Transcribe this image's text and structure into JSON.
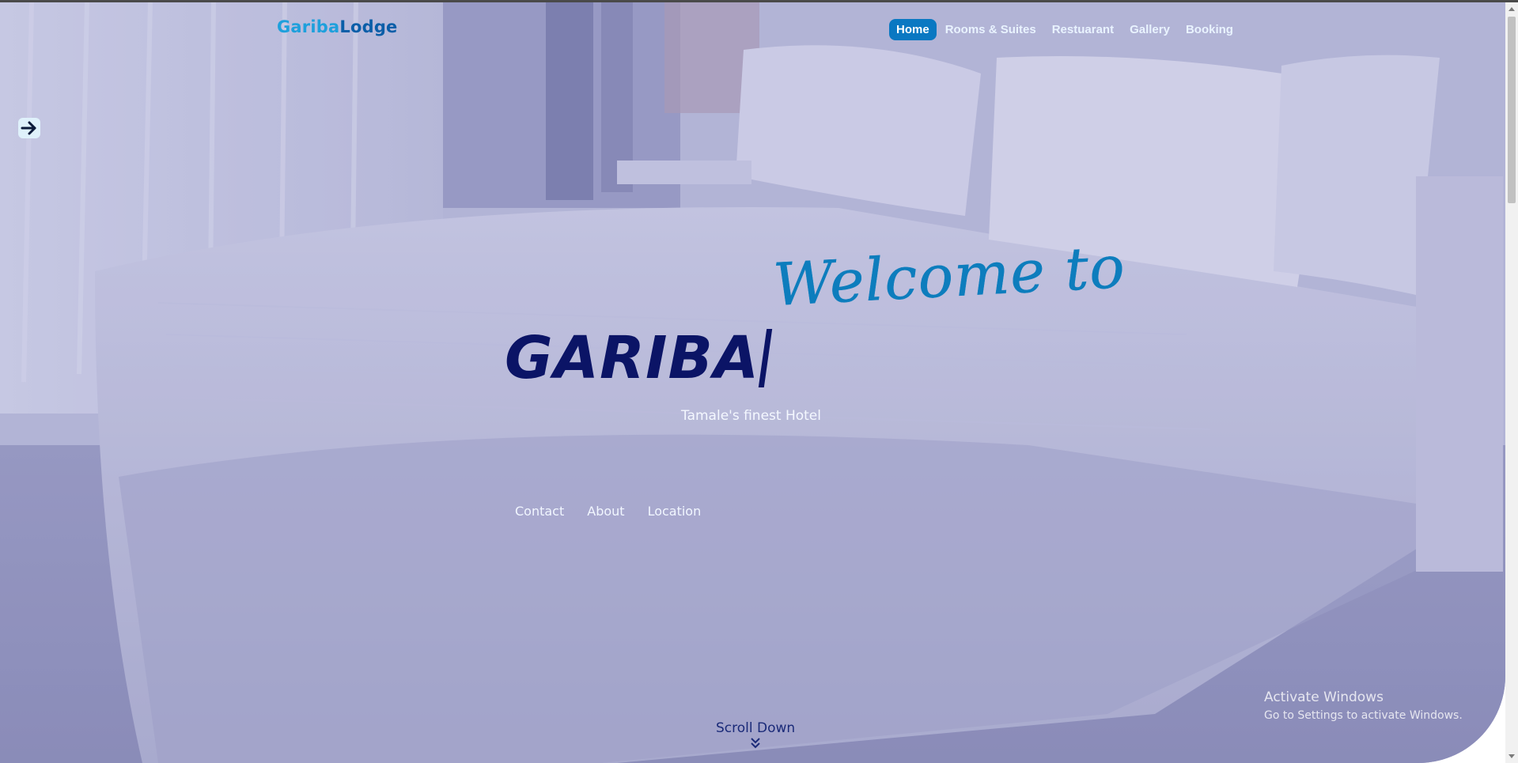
{
  "brand": {
    "logo_part1": "Gariba",
    "logo_part2": "Lodge"
  },
  "nav": {
    "items": [
      {
        "label": "Home",
        "active": true
      },
      {
        "label": "Rooms & Suites",
        "active": false
      },
      {
        "label": "Restuarant",
        "active": false
      },
      {
        "label": "Gallery",
        "active": false
      },
      {
        "label": "Booking",
        "active": false
      }
    ]
  },
  "hero": {
    "welcome": "Welcome to",
    "title": "GARIBA",
    "tagline": "Tamale's finest Hotel",
    "links": [
      "Contact",
      "About",
      "Location"
    ],
    "scroll_label": "Scroll Down"
  },
  "sidebar_toggle": {
    "icon": "arrow-right-icon"
  },
  "watermark": {
    "line1": "Activate Windows",
    "line2": "Go to Settings to activate Windows."
  },
  "colors": {
    "accent": "#0a78c2",
    "logo_light": "#1ea0dc",
    "logo_dark": "#0a5ea8",
    "title": "#0b1466",
    "welcome": "#0d7dbd"
  }
}
